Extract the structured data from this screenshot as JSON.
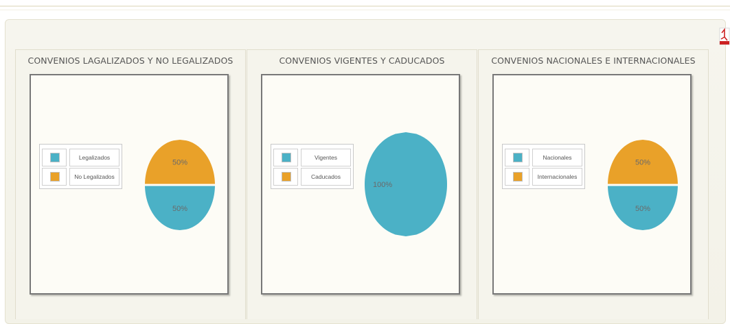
{
  "colors": {
    "teal": "#4bb1c6",
    "orange": "#e9a129"
  },
  "icons": {
    "export": "pdf-icon"
  },
  "chart_data": [
    {
      "type": "pie",
      "title": "CONVENIOS LAGALIZADOS Y NO LEGALIZADOS",
      "legend": "left",
      "series": [
        {
          "name": "Legalizados",
          "value": 50,
          "label": "50%",
          "color": "#4bb1c6"
        },
        {
          "name": "No Legalizados",
          "value": 50,
          "label": "50%",
          "color": "#e9a129"
        }
      ]
    },
    {
      "type": "pie",
      "title": "CONVENIOS VIGENTES Y CADUCADOS",
      "legend": "left",
      "series": [
        {
          "name": "Vigentes",
          "value": 100,
          "label": "100%",
          "color": "#4bb1c6"
        },
        {
          "name": "Caducados",
          "value": 0,
          "label": "",
          "color": "#e9a129"
        }
      ]
    },
    {
      "type": "pie",
      "title": "CONVENIOS NACIONALES E INTERNACIONALES",
      "legend": "left",
      "series": [
        {
          "name": "Nacionales",
          "value": 50,
          "label": "50%",
          "color": "#4bb1c6"
        },
        {
          "name": "Internacionales",
          "value": 50,
          "label": "50%",
          "color": "#e9a129"
        }
      ]
    }
  ]
}
